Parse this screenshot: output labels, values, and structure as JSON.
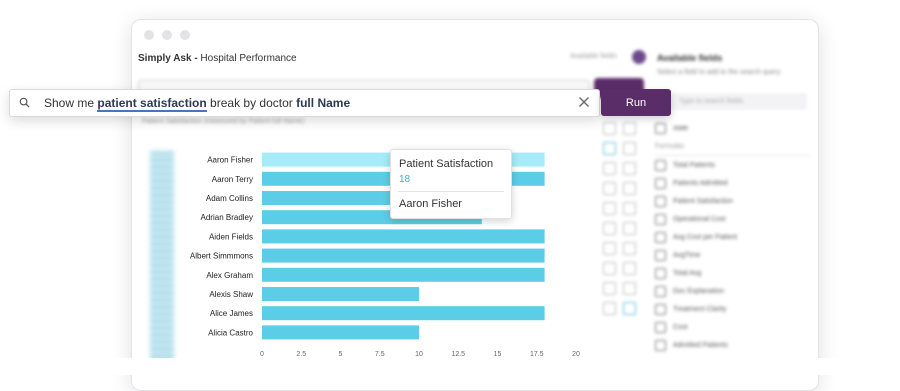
{
  "app": {
    "title_bold": "Simply Ask -",
    "title_rest": " Hospital Performance"
  },
  "query": {
    "prefix": "Show me ",
    "kw1": "patient satisfaction",
    "mid": " break by doctor ",
    "kw2": "full Name",
    "run_label": "Run"
  },
  "background": {
    "breadcrumb": "Patient Satisfaction (measured by Patient full Name)",
    "available_fields_top": "Available fields",
    "available_fields_title": "Available fields",
    "available_fields_subtitle": "Select a field to add to the search query",
    "search_placeholder": "Type to search fields",
    "field_state": "state",
    "formulas_label": "Formulas",
    "formulas": [
      "Total Patients",
      "Patients Admitted",
      "Patient Satisfaction",
      "Operational Cost",
      "Avg Cost per Patient",
      "AvgTime",
      "Total Avg",
      "Doc Explanation",
      "Treatment Clarity",
      "Cost",
      "Admitted Patients"
    ]
  },
  "tooltip": {
    "measure": "Patient Satisfaction",
    "value": "18",
    "name": "Aaron Fisher"
  },
  "chart_data": {
    "type": "bar",
    "orientation": "horizontal",
    "categories": [
      "Aaron Fisher",
      "Aaron Terry",
      "Adam Collins",
      "Adrian Bradley",
      "Aiden Fields",
      "Albert Simmmons",
      "Alex Graham",
      "Alexis Shaw",
      "Alice James",
      "Alicia Castro"
    ],
    "values": [
      18,
      18,
      10,
      14,
      18,
      18,
      18,
      10,
      18,
      10
    ],
    "xlim": [
      0,
      20
    ],
    "xticks": [
      "0",
      "2.5",
      "5",
      "7.5",
      "10",
      "12.5",
      "15",
      "17.5",
      "20"
    ],
    "bar_color": "#5ccde6",
    "highlight_color": "#a6ecf8"
  }
}
